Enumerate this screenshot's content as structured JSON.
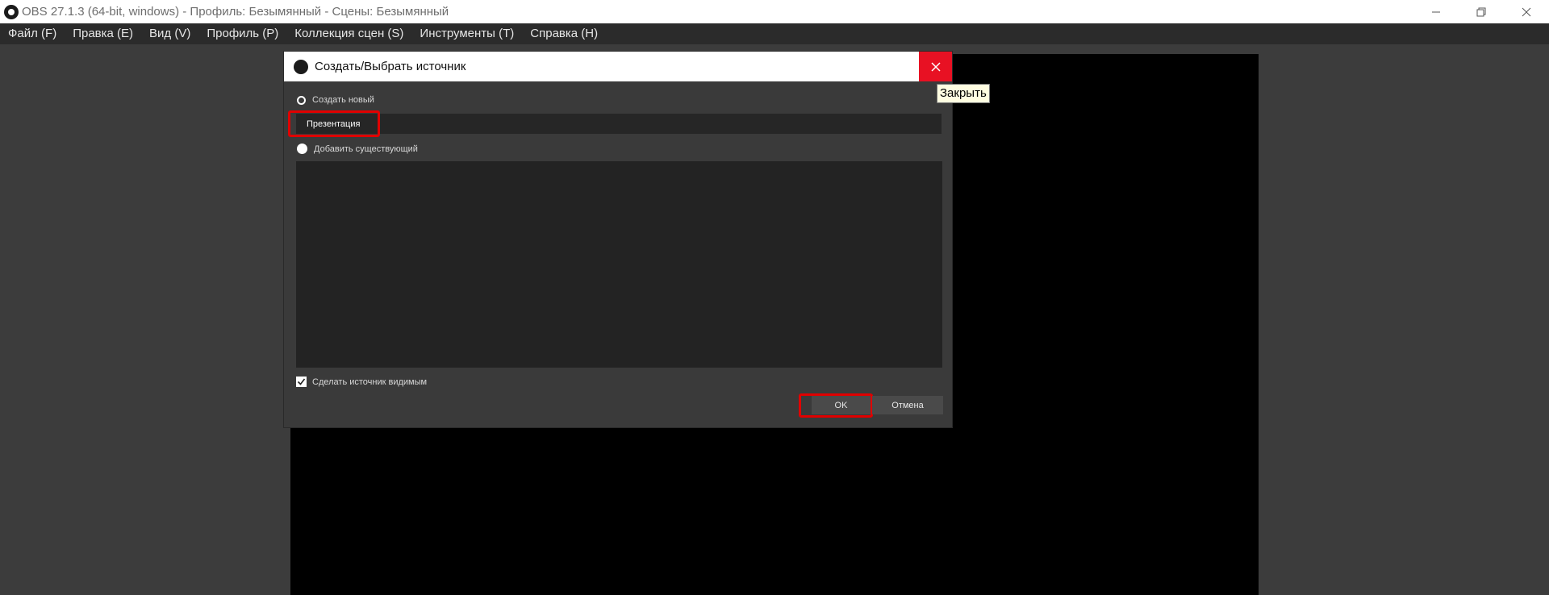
{
  "window": {
    "title": "OBS 27.1.3 (64-bit, windows) - Профиль: Безымянный - Сцены: Безымянный"
  },
  "menu": {
    "items": [
      "Файл (F)",
      "Правка (E)",
      "Вид (V)",
      "Профиль (P)",
      "Коллекция сцен (S)",
      "Инструменты (T)",
      "Справка (H)"
    ]
  },
  "dialog": {
    "title": "Создать/Выбрать источник",
    "create_new_label": "Создать новый",
    "name_value": "Презентация",
    "add_existing_label": "Добавить существующий",
    "make_visible_label": "Сделать источник видимым",
    "make_visible_checked": true,
    "ok_label": "OK",
    "cancel_label": "Отмена"
  },
  "tooltip": {
    "text": "Закрыть"
  },
  "colors": {
    "close_red": "#e81123",
    "highlight_red": "#e00000",
    "dialog_bg": "#3a3a3a",
    "preview_bg": "#000000"
  }
}
